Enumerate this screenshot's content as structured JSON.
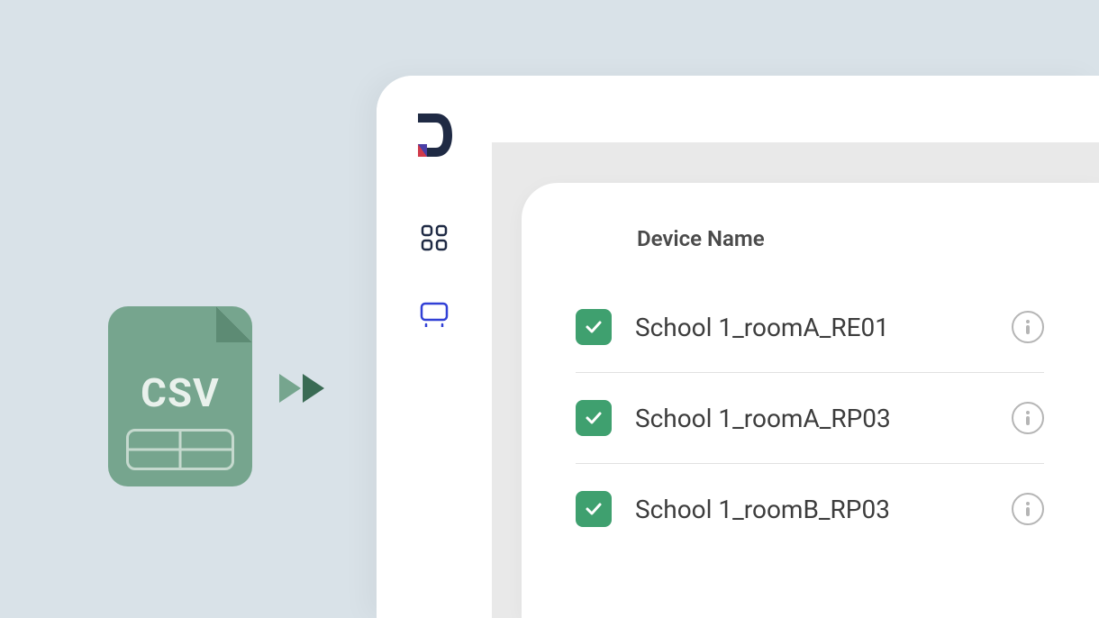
{
  "csv": {
    "label": "CSV"
  },
  "list": {
    "header": "Device Name",
    "rows": [
      {
        "name": "School 1_roomA_RE01",
        "checked": true
      },
      {
        "name": "School 1_roomA_RP03",
        "checked": true
      },
      {
        "name": "School 1_roomB_RP03",
        "checked": true
      }
    ]
  },
  "icons": {
    "logo": "brand-logo",
    "dashboard": "dashboard-icon",
    "display": "display-icon",
    "info": "info-icon",
    "check": "checkmark-icon",
    "arrow": "arrow-right-icon"
  }
}
